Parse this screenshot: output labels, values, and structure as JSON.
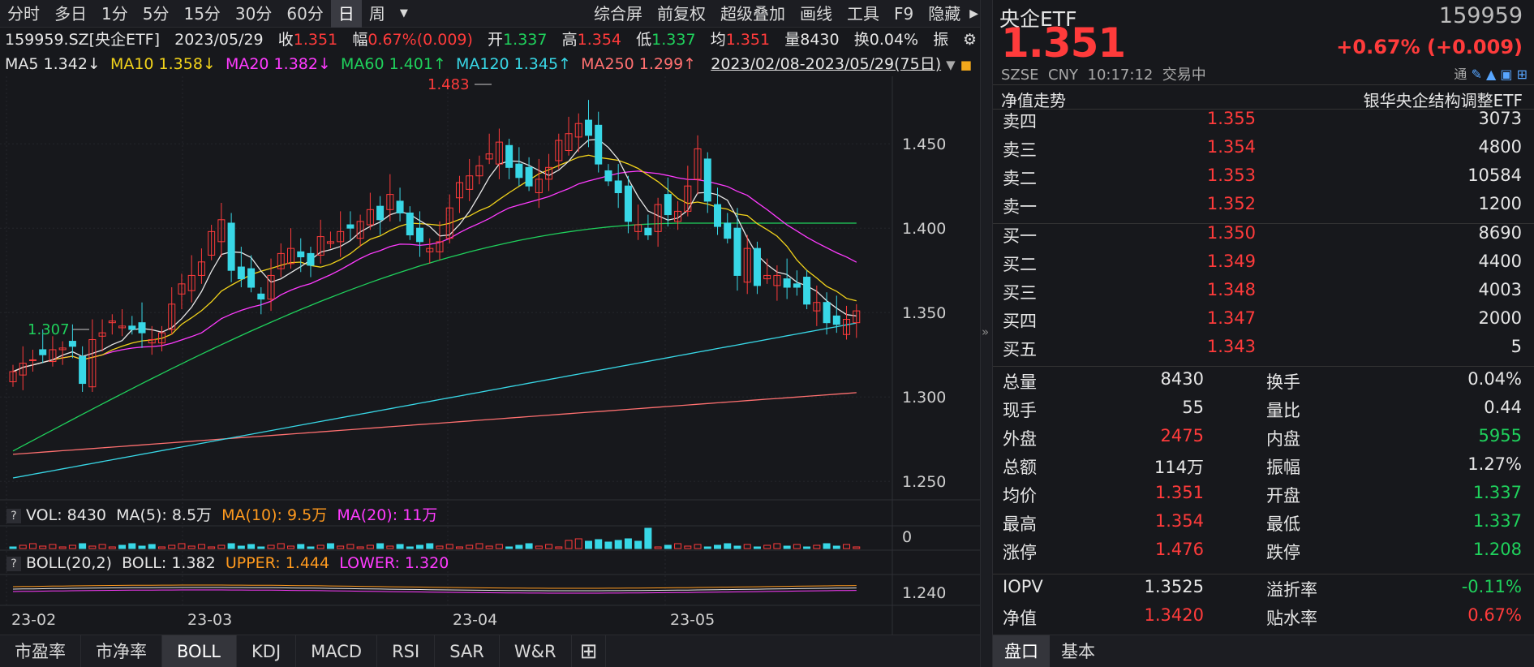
{
  "toolbar": {
    "periods": [
      "分时",
      "多日",
      "1分",
      "5分",
      "15分",
      "30分",
      "60分",
      "日",
      "周"
    ],
    "active_period": "日",
    "tools": [
      "综合屏",
      "前复权",
      "超级叠加",
      "画线",
      "工具",
      "F9",
      "隐藏"
    ]
  },
  "info": {
    "code_name": "159959.SZ[央企ETF]",
    "date": "2023/05/29",
    "close_label": "收",
    "close": "1.351",
    "range_label": "幅",
    "range": "0.67%(0.009)",
    "open_label": "开",
    "open": "1.337",
    "high_label": "高",
    "high": "1.354",
    "low_label": "低",
    "low": "1.337",
    "avg_label": "均",
    "avg": "1.351",
    "vol_label": "量",
    "vol": "8430",
    "turnover_label": "换",
    "turnover": "0.04%",
    "amp_label": "振"
  },
  "ma": {
    "ma5": "MA5 1.342↓",
    "ma10": "MA10 1.358↓",
    "ma20": "MA20 1.382↓",
    "ma60": "MA60 1.401↑",
    "ma120": "MA120 1.345↑",
    "ma250": "MA250 1.299↑",
    "range": "2023/02/08-2023/05/29(75日)"
  },
  "chart_data": {
    "type": "candlestick",
    "y_ticks": [
      "1.450",
      "1.400",
      "1.350",
      "1.300",
      "1.250"
    ],
    "ylim": [
      1.24,
      1.49
    ],
    "x_ticks": [
      "23-02",
      "23-03",
      "23-04",
      "23-05"
    ],
    "marker_high": "1.483",
    "marker_low": "1.307",
    "colors": {
      "up": "#ff3b3b",
      "down": "#38d7e6",
      "ma5": "#e6e6e6",
      "ma10": "#f2d31b",
      "ma20": "#ff3bff",
      "ma60": "#1fd15c",
      "ma120": "#38d7e6",
      "ma250": "#ff7070"
    },
    "closes": [
      1.315,
      1.32,
      1.322,
      1.325,
      1.328,
      1.329,
      1.33,
      1.308,
      1.334,
      1.338,
      1.345,
      1.342,
      1.34,
      1.338,
      1.334,
      1.338,
      1.355,
      1.367,
      1.372,
      1.38,
      1.398,
      1.405,
      1.375,
      1.37,
      1.365,
      1.358,
      1.372,
      1.385,
      1.388,
      1.383,
      1.378,
      1.395,
      1.392,
      1.398,
      1.4,
      1.404,
      1.411,
      1.405,
      1.42,
      1.409,
      1.396,
      1.392,
      1.388,
      1.392,
      1.412,
      1.427,
      1.431,
      1.437,
      1.444,
      1.451,
      1.436,
      1.43,
      1.425,
      1.429,
      1.436,
      1.452,
      1.456,
      1.462,
      1.455,
      1.438,
      1.428,
      1.421,
      1.404,
      1.402,
      1.396,
      1.414,
      1.408,
      1.41,
      1.425,
      1.447,
      1.416,
      1.401,
      1.394,
      1.372,
      1.388,
      1.366,
      1.372,
      1.372,
      1.365,
      1.365,
      1.355,
      1.356,
      1.344,
      1.343,
      1.346,
      1.351
    ]
  },
  "vol_panel": {
    "label": "VOL: 8430",
    "ma5": "MA(5): 8.5万",
    "ma10": "MA(10): 9.5万",
    "ma20": "MA(20): 11万",
    "tick": "0"
  },
  "boll_panel": {
    "label": "BOLL(20,2)",
    "boll": "BOLL: 1.382",
    "upper": "UPPER: 1.444",
    "lower": "LOWER: 1.320",
    "tick": "1.240"
  },
  "bottom_tabs": [
    "市盈率",
    "市净率",
    "BOLL",
    "KDJ",
    "MACD",
    "RSI",
    "SAR",
    "W&R"
  ],
  "active_bottom_tab": "BOLL",
  "quote": {
    "name": "央企ETF",
    "code": "159959",
    "price": "1.351",
    "change": "+0.67%",
    "change_abs": "(+0.009)",
    "exchange": "SZSE",
    "currency": "CNY",
    "time": "10:17:12",
    "status": "交易中",
    "nav_trend": "净值走势",
    "fund_name": "银华央企结构调整ETF",
    "link_label": "通"
  },
  "order_book": {
    "asks": [
      {
        "label": "卖四",
        "price": "1.355",
        "vol": "3073"
      },
      {
        "label": "卖三",
        "price": "1.354",
        "vol": "4800"
      },
      {
        "label": "卖二",
        "price": "1.353",
        "vol": "10584"
      },
      {
        "label": "卖一",
        "price": "1.352",
        "vol": "1200"
      }
    ],
    "bids": [
      {
        "label": "买一",
        "price": "1.350",
        "vol": "8690"
      },
      {
        "label": "买二",
        "price": "1.349",
        "vol": "4400"
      },
      {
        "label": "买三",
        "price": "1.348",
        "vol": "4003"
      },
      {
        "label": "买四",
        "price": "1.347",
        "vol": "2000"
      },
      {
        "label": "买五",
        "price": "1.343",
        "vol": "5"
      }
    ]
  },
  "stats": [
    {
      "l1": "总量",
      "v1": "8430",
      "c1": "white",
      "l2": "换手",
      "v2": "0.04%",
      "c2": "white"
    },
    {
      "l1": "现手",
      "v1": "55",
      "c1": "white",
      "l2": "量比",
      "v2": "0.44",
      "c2": "white"
    },
    {
      "l1": "外盘",
      "v1": "2475",
      "c1": "red",
      "l2": "内盘",
      "v2": "5955",
      "c2": "green"
    },
    {
      "l1": "总额",
      "v1": "114万",
      "c1": "white",
      "l2": "振幅",
      "v2": "1.27%",
      "c2": "white"
    },
    {
      "l1": "均价",
      "v1": "1.351",
      "c1": "red",
      "l2": "开盘",
      "v2": "1.337",
      "c2": "green"
    },
    {
      "l1": "最高",
      "v1": "1.354",
      "c1": "red",
      "l2": "最低",
      "v2": "1.337",
      "c2": "green"
    },
    {
      "l1": "涨停",
      "v1": "1.476",
      "c1": "red",
      "l2": "跌停",
      "v2": "1.208",
      "c2": "green"
    }
  ],
  "iopv": [
    {
      "l1": "IOPV",
      "v1": "1.3525",
      "c1": "white",
      "l2": "溢折率",
      "v2": "-0.11%",
      "c2": "green"
    },
    {
      "l1": "净值",
      "v1": "1.3420",
      "c1": "red",
      "l2": "贴水率",
      "v2": "0.67%",
      "c2": "red"
    }
  ],
  "right_tabs": [
    "盘口",
    "基本"
  ],
  "active_right_tab": "盘口"
}
